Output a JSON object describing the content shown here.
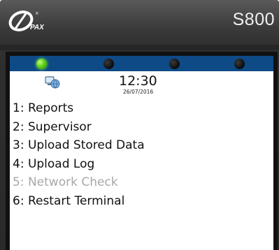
{
  "device": {
    "brand": "PAX",
    "model": "S800"
  },
  "leds": [
    {
      "state": "on",
      "color": "#5ccf1a"
    },
    {
      "state": "off",
      "color": "#111111"
    },
    {
      "state": "off",
      "color": "#111111"
    },
    {
      "state": "off",
      "color": "#111111"
    }
  ],
  "status": {
    "icon": "network-globe-icon",
    "time": "12:30",
    "date": "26/07/2016"
  },
  "menu": {
    "items": [
      {
        "label": "1: Reports",
        "enabled": true
      },
      {
        "label": "2: Supervisor",
        "enabled": true
      },
      {
        "label": "3: Upload Stored Data",
        "enabled": true
      },
      {
        "label": "4: Upload Log",
        "enabled": true
      },
      {
        "label": "5: Network Check",
        "enabled": false
      },
      {
        "label": "6: Restart Terminal",
        "enabled": true
      }
    ]
  },
  "colors": {
    "led_bar": "#0e4a86",
    "screen_bg": "#ffffff",
    "disabled_text": "#a8a8a8"
  }
}
